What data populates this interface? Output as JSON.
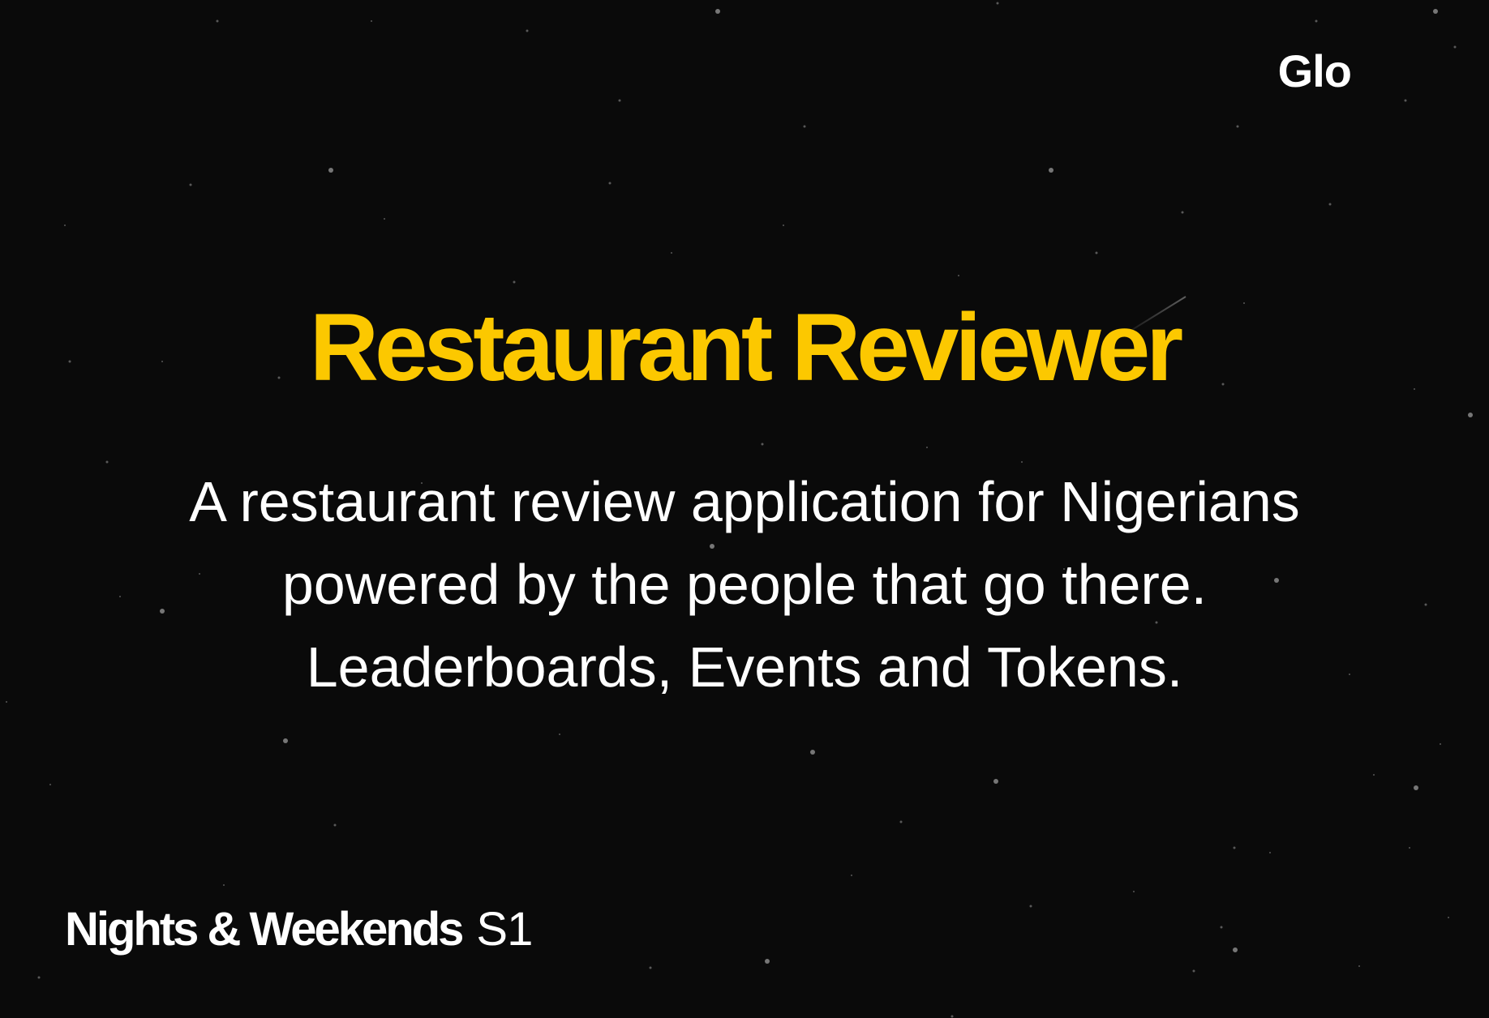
{
  "team": "Glo",
  "title": "Restaurant Reviewer",
  "description": "A restaurant review application for Nigerians powered by the people that go there. Leaderboards, Events and Tokens.",
  "brand": {
    "name": "Nights & Weekends",
    "season": "S1"
  },
  "colors": {
    "background": "#0a0a0a",
    "title": "#fcc800",
    "text": "#ffffff",
    "star": "#cfcfcf"
  }
}
